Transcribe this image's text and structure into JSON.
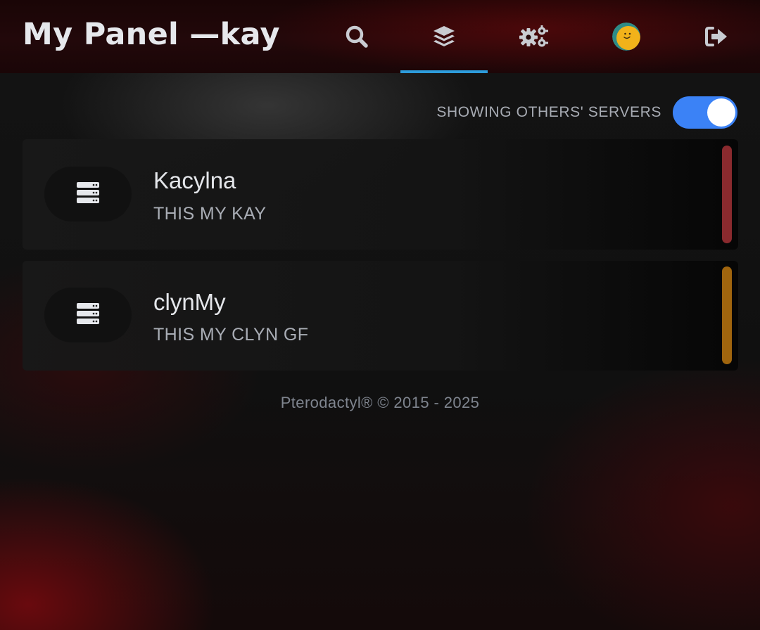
{
  "header": {
    "title": "My Panel —kay"
  },
  "nav": {
    "items": [
      {
        "name": "search",
        "icon": "search-icon"
      },
      {
        "name": "servers",
        "icon": "layers-icon",
        "active": true
      },
      {
        "name": "admin",
        "icon": "cogs-icon"
      },
      {
        "name": "account",
        "icon": "avatar-icon"
      },
      {
        "name": "logout",
        "icon": "sign-out-icon"
      }
    ],
    "active_color": "#2d9cdb"
  },
  "toggle": {
    "label": "SHOWING OTHERS' SERVERS",
    "on": true,
    "color": "#3b82f6"
  },
  "servers": [
    {
      "name": "Kacylna",
      "description": "THIS MY KAY",
      "icon": "server-icon",
      "status_color": "#8a2a2e"
    },
    {
      "name": "clynMy",
      "description": "THIS MY CLYN GF",
      "icon": "server-icon",
      "status_color": "#a0650e"
    }
  ],
  "footer": {
    "text": "Pterodactyl® © 2015 - 2025"
  }
}
